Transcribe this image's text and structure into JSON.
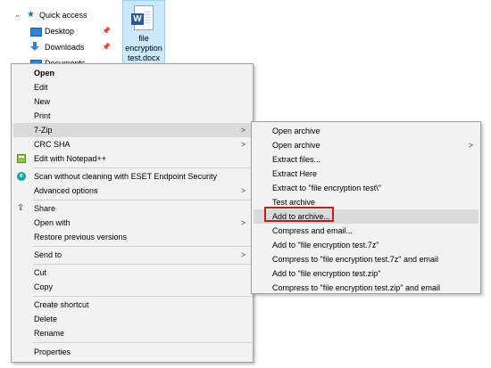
{
  "nav": {
    "quick_access": "Quick access",
    "items": [
      {
        "label": "Desktop",
        "icon": "desktop-folder-icon"
      },
      {
        "label": "Downloads",
        "icon": "downloads-icon"
      },
      {
        "label": "Documents",
        "icon": "documents-icon"
      }
    ],
    "pin_glyph": "📌"
  },
  "file": {
    "name_line1": "file",
    "name_line2": "encryption",
    "name_line3": "test.docx",
    "type_letter": "W"
  },
  "context_menu": {
    "items": [
      {
        "label": "Open"
      },
      {
        "label": "Edit"
      },
      {
        "label": "New"
      },
      {
        "label": "Print"
      },
      {
        "label": "7-Zip"
      },
      {
        "label": "CRC SHA"
      },
      {
        "label": "Edit with Notepad++"
      },
      {
        "label": "Scan without cleaning with ESET Endpoint Security"
      },
      {
        "label": "Advanced options"
      },
      {
        "label": "Share"
      },
      {
        "label": "Open with"
      },
      {
        "label": "Restore previous versions"
      },
      {
        "label": "Send to"
      },
      {
        "label": "Cut"
      },
      {
        "label": "Copy"
      },
      {
        "label": "Create shortcut"
      },
      {
        "label": "Delete"
      },
      {
        "label": "Rename"
      },
      {
        "label": "Properties"
      }
    ]
  },
  "submenu_7zip": {
    "items": [
      {
        "label": "Open archive"
      },
      {
        "label": "Open archive"
      },
      {
        "label": "Extract files..."
      },
      {
        "label": "Extract Here"
      },
      {
        "label": "Extract to \"file encryption test\\\""
      },
      {
        "label": "Test archive"
      },
      {
        "label": "Add to archive..."
      },
      {
        "label": "Compress and email..."
      },
      {
        "label": "Add to \"file encryption test.7z\""
      },
      {
        "label": "Compress to \"file encryption test.7z\" and email"
      },
      {
        "label": "Add to \"file encryption test.zip\""
      },
      {
        "label": "Compress to \"file encryption test.zip\" and email"
      }
    ]
  },
  "colors": {
    "highlight_box": "#d0161b",
    "selection_bg": "#cce8ff",
    "menu_bg": "#f2f2f2"
  }
}
